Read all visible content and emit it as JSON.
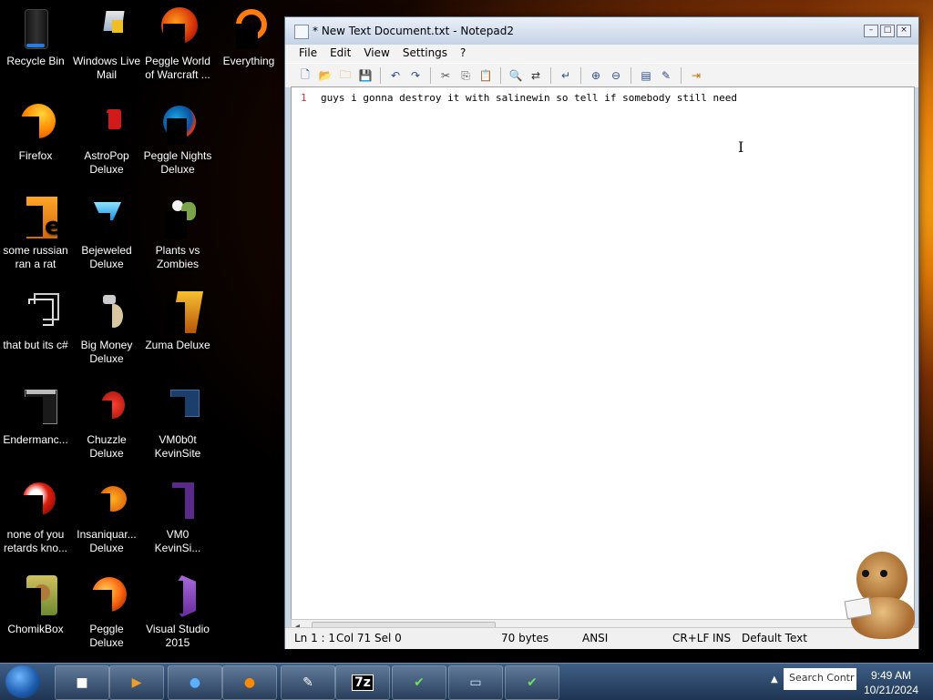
{
  "desktop": {
    "icons": [
      {
        "label": "Recycle Bin"
      },
      {
        "label": "Windows Live Mail"
      },
      {
        "label": "Peggle World of Warcraft ..."
      },
      {
        "label": "Everything"
      },
      {
        "label": "Firefox"
      },
      {
        "label": "AstroPop Deluxe"
      },
      {
        "label": "Peggle Nights Deluxe"
      },
      {
        "label": "some russian ran a rat"
      },
      {
        "label": "Bejeweled Deluxe"
      },
      {
        "label": "Plants vs Zombies"
      },
      {
        "label": "that but its c#"
      },
      {
        "label": "Big Money Deluxe"
      },
      {
        "label": "Zuma Deluxe"
      },
      {
        "label": "Endermanc..."
      },
      {
        "label": "Chuzzle Deluxe"
      },
      {
        "label": "VM0b0t KevinSite"
      },
      {
        "label": "none of you retards kno..."
      },
      {
        "label": "Insaniquar... Deluxe"
      },
      {
        "label": "VM0 KevinSi..."
      },
      {
        "label": "ChomikBox"
      },
      {
        "label": "Peggle Deluxe"
      },
      {
        "label": "Visual Studio 2015"
      }
    ]
  },
  "window": {
    "title": "* New Text Document.txt - Notepad2",
    "menu": [
      "File",
      "Edit",
      "View",
      "Settings",
      "?"
    ],
    "editor": {
      "line_number": "1",
      "text": "guys i gonna destroy it with salinewin so tell if somebody still need "
    },
    "status": {
      "position": "Ln 1 : 1",
      "column": "Col 71",
      "selection": "Sel 0",
      "size": "70 bytes",
      "encoding": "ANSI",
      "line_ending": "CR+LF",
      "insert_mode": "INS",
      "scheme": "Default Text"
    }
  },
  "taskbar": {
    "search_placeholder": "Search Contr",
    "time": "9:49 AM",
    "date": "10/21/2024"
  }
}
